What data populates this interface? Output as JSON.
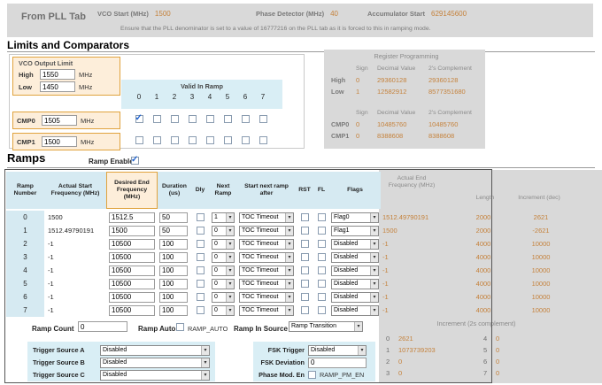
{
  "top_bar": {
    "title": "From PLL Tab",
    "fields": [
      {
        "label": "VCO Start (MHz)",
        "value": "1500"
      },
      {
        "label": "Phase Detector (MHz)",
        "value": "40"
      },
      {
        "label": "Accumulator Start",
        "value": "629145600"
      }
    ],
    "note": "Ensure that the PLL denominator is set to a value of 16777216 on the PLL tab as it is forced to this in ramping mode."
  },
  "limits": {
    "heading": "Limits and Comparators",
    "vco_limit": {
      "title": "VCO Output Limit",
      "rows": [
        {
          "label": "High",
          "value": "1550",
          "unit": "MHz"
        },
        {
          "label": "Low",
          "value": "1450",
          "unit": "MHz"
        }
      ]
    },
    "valid_in_ramp": {
      "title": "Valid In Ramp",
      "columns": [
        "0",
        "1",
        "2",
        "3",
        "4",
        "5",
        "6",
        "7"
      ]
    },
    "comparators": [
      {
        "label": "CMP0",
        "value": "1505",
        "unit": "MHz",
        "checks": [
          true,
          false,
          false,
          false,
          false,
          false,
          false,
          false
        ]
      },
      {
        "label": "CMP1",
        "value": "1500",
        "unit": "MHz",
        "checks": [
          false,
          false,
          false,
          false,
          false,
          false,
          false,
          false
        ]
      }
    ],
    "register_programming": {
      "title": "Register Programming",
      "headers": [
        "Sign",
        "Decimal Value",
        "2's Complement"
      ],
      "groups": [
        {
          "rows": [
            {
              "label": "High",
              "sign": "0",
              "decimal": "29360128",
              "complement": "29360128"
            },
            {
              "label": "Low",
              "sign": "1",
              "decimal": "12582912",
              "complement": "8577351680"
            }
          ]
        },
        {
          "rows": [
            {
              "label": "CMP0",
              "sign": "0",
              "decimal": "10485760",
              "complement": "10485760"
            },
            {
              "label": "CMP1",
              "sign": "0",
              "decimal": "8388608",
              "complement": "8388608"
            }
          ]
        }
      ]
    }
  },
  "ramps": {
    "heading": "Ramps",
    "ramp_enable": {
      "label": "Ramp Enable",
      "checked": true
    },
    "table": {
      "headers": {
        "num": "Ramp Number",
        "start": "Actual Start Frequency (MHz)",
        "end": "Desired End Frequency (MHz)",
        "dur": "Duration (us)",
        "dly": "Dly",
        "next": "Next Ramp",
        "after": "Start next ramp after",
        "rst": "RST",
        "fl": "FL",
        "flags": "Flags"
      },
      "rows": [
        {
          "num": "0",
          "start": "1500",
          "end": "1512.5",
          "duration": "50",
          "dly": false,
          "next": "1",
          "after": "TOC Timeout",
          "rst": false,
          "fl": false,
          "flags": "Flag0"
        },
        {
          "num": "1",
          "start": "1512.49790191",
          "end": "1500",
          "duration": "50",
          "dly": false,
          "next": "0",
          "after": "TOC Timeout",
          "rst": false,
          "fl": false,
          "flags": "Flag1"
        },
        {
          "num": "2",
          "start": "-1",
          "end": "10500",
          "duration": "100",
          "dly": false,
          "next": "0",
          "after": "TOC Timeout",
          "rst": false,
          "fl": false,
          "flags": "Disabled"
        },
        {
          "num": "3",
          "start": "-1",
          "end": "10500",
          "duration": "100",
          "dly": false,
          "next": "0",
          "after": "TOC Timeout",
          "rst": false,
          "fl": false,
          "flags": "Disabled"
        },
        {
          "num": "4",
          "start": "-1",
          "end": "10500",
          "duration": "100",
          "dly": false,
          "next": "0",
          "after": "TOC Timeout",
          "rst": false,
          "fl": false,
          "flags": "Disabled"
        },
        {
          "num": "5",
          "start": "-1",
          "end": "10500",
          "duration": "100",
          "dly": false,
          "next": "0",
          "after": "TOC Timeout",
          "rst": false,
          "fl": false,
          "flags": "Disabled"
        },
        {
          "num": "6",
          "start": "-1",
          "end": "10500",
          "duration": "100",
          "dly": false,
          "next": "0",
          "after": "TOC Timeout",
          "rst": false,
          "fl": false,
          "flags": "Disabled"
        },
        {
          "num": "7",
          "start": "-1",
          "end": "10500",
          "duration": "100",
          "dly": false,
          "next": "0",
          "after": "TOC Timeout",
          "rst": false,
          "fl": false,
          "flags": "Disabled"
        }
      ]
    },
    "end_panel": {
      "headers": {
        "freq": "Actual End Frequency (MHz)",
        "length": "Length",
        "inc": "Increment (dec)"
      },
      "rows": [
        {
          "freq": "1512.49790191",
          "length": "2000",
          "inc": "2621"
        },
        {
          "freq": "1500",
          "length": "2000",
          "inc": "-2621"
        },
        {
          "freq": "-1",
          "length": "4000",
          "inc": "10000"
        },
        {
          "freq": "-1",
          "length": "4000",
          "inc": "10000"
        },
        {
          "freq": "-1",
          "length": "4000",
          "inc": "10000"
        },
        {
          "freq": "-1",
          "length": "4000",
          "inc": "10000"
        },
        {
          "freq": "-1",
          "length": "4000",
          "inc": "10000"
        },
        {
          "freq": "-1",
          "length": "4000",
          "inc": "10000"
        }
      ]
    },
    "controls": {
      "ramp_count_label": "Ramp Count",
      "ramp_count_value": "0",
      "ramp_auto_label": "Ramp Auto",
      "ramp_auto_checkbox_label": "RAMP_AUTO",
      "ramp_auto_checked": false,
      "ramp_in_source_label": "Ramp In Source",
      "ramp_in_source_value": "Ramp Transition"
    },
    "increment_panel": {
      "title": "Increment (2s complement)",
      "entries": [
        {
          "index": "0",
          "value": "2621"
        },
        {
          "index": "1",
          "value": "1073739203"
        },
        {
          "index": "2",
          "value": "0"
        },
        {
          "index": "3",
          "value": "0"
        },
        {
          "index": "4",
          "value": "0"
        },
        {
          "index": "5",
          "value": "0"
        },
        {
          "index": "6",
          "value": "0"
        },
        {
          "index": "7",
          "value": "0"
        }
      ]
    },
    "trigger_sources": [
      {
        "label": "Trigger Source A",
        "value": "Disabled"
      },
      {
        "label": "Trigger Source B",
        "value": "Disabled"
      },
      {
        "label": "Trigger Source C",
        "value": "Disabled"
      }
    ],
    "fsk": {
      "trigger_label": "FSK Trigger",
      "trigger_value": "Disabled",
      "deviation_label": "FSK Deviation",
      "deviation_value": "0",
      "phase_mod_label": "Phase Mod. En",
      "phase_mod_checkbox_label": "RAMP_PM_EN",
      "phase_mod_checked": false
    }
  },
  "colors": {
    "accent_orange": "#c5823c",
    "panel_gray": "#d9d9d9",
    "peach": "#fdeeda",
    "light_blue": "#d9eef5",
    "header_blue": "#d6eaf2",
    "check_blue": "#1f62d0"
  }
}
